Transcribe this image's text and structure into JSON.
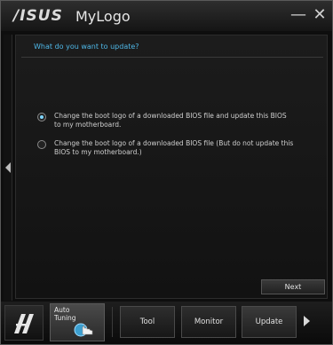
{
  "window": {
    "brand": "/ISUS",
    "title": "MyLogo",
    "minimize_glyph": "—",
    "close_glyph": "✕"
  },
  "main": {
    "question": "What do you want to update?",
    "options": [
      {
        "label": "Change the boot logo of a downloaded BIOS file and update this BIOS to my motherboard.",
        "selected": true
      },
      {
        "label": "Change the boot logo of a downloaded BIOS file (But do not update this BIOS to my motherboard.)",
        "selected": false
      }
    ],
    "next_label": "Next"
  },
  "bottombar": {
    "auto_tuning_label": "Auto Tuning",
    "nav": [
      {
        "label": "Tool"
      },
      {
        "label": "Monitor"
      },
      {
        "label": "Update"
      }
    ]
  },
  "colors": {
    "accent": "#4fb8e8",
    "background": "#0e0e0e",
    "text": "#cfcfcf"
  }
}
